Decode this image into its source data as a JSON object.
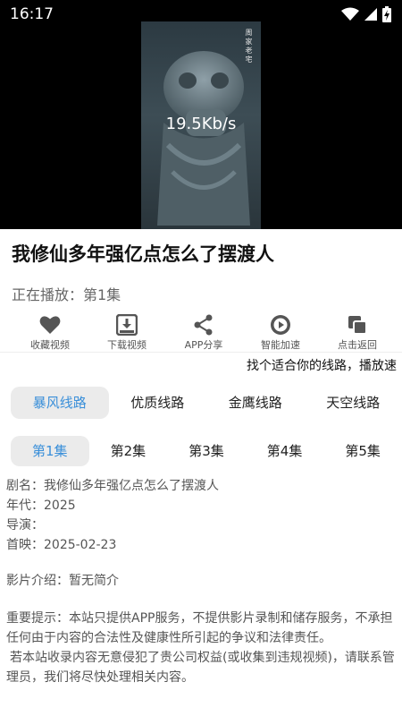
{
  "status_bar": {
    "time": "16:17"
  },
  "video": {
    "speed_text": "19.5Kb/s",
    "watermark": "周家老宅"
  },
  "title": "我修仙多年强亿点怎么了摆渡人",
  "now_playing": "正在播放：第1集",
  "actions": [
    {
      "label": "收藏视频",
      "icon": "heart-icon"
    },
    {
      "label": "下载视频",
      "icon": "download-icon"
    },
    {
      "label": "APP分享",
      "icon": "share-icon"
    },
    {
      "label": "智能加速",
      "icon": "play-circle-icon"
    },
    {
      "label": "点击返回",
      "icon": "copy-icon"
    }
  ],
  "marquee": "找个适合你的线路，播放速",
  "lines": [
    {
      "label": "暴风线路",
      "active": true
    },
    {
      "label": "优质线路",
      "active": false
    },
    {
      "label": "金鹰线路",
      "active": false
    },
    {
      "label": "天空线路",
      "active": false
    }
  ],
  "episodes": [
    {
      "label": "第1集",
      "active": true
    },
    {
      "label": "第2集",
      "active": false
    },
    {
      "label": "第3集",
      "active": false
    },
    {
      "label": "第4集",
      "active": false
    },
    {
      "label": "第5集",
      "active": false
    }
  ],
  "info": {
    "name": "剧名：我修仙多年强亿点怎么了摆渡人",
    "year": "年代：2025",
    "director": "导演：",
    "premiere": "首映：2025-02-23"
  },
  "intro": "影片介绍：暂无简介",
  "notice_line1": "重要提示：本站只提供APP服务，不提供影片录制和储存服务，不承担任何由于内容的合法性及健康性所引起的争议和法律责任。",
  "notice_line2": "若本站收录内容无意侵犯了贵公司权益(或收集到违规视频)，请联系管理员，我们将尽快处理相关内容。",
  "colors": {
    "accent": "#3a8fd9",
    "tab_bg": "#ebebeb",
    "icon": "#555555"
  }
}
